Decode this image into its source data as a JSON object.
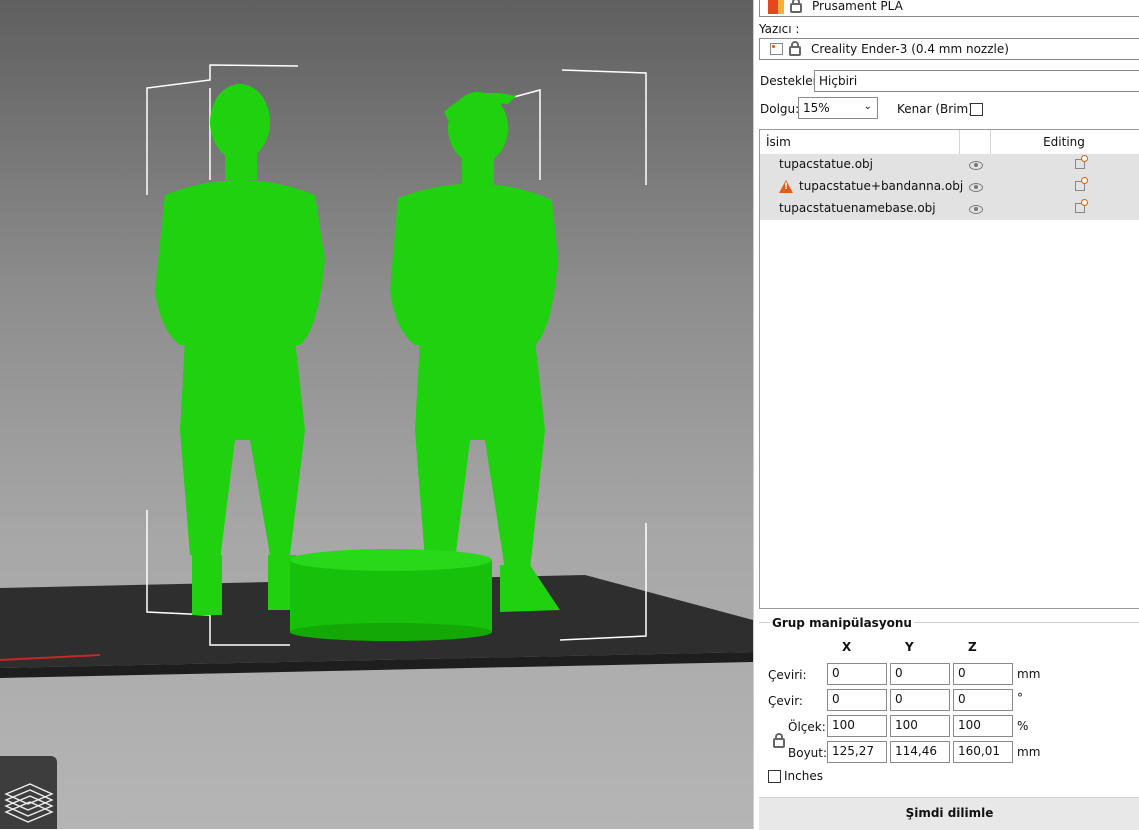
{
  "filament": {
    "value": "Prusament PLA",
    "swatch_colors": [
      "#e8461f",
      "#f2b233"
    ]
  },
  "printer": {
    "label": "Yazıcı :",
    "value": "Creality Ender-3 (0.4 mm nozzle)"
  },
  "supports": {
    "label": "Destekler:",
    "value": "Hiçbiri"
  },
  "infill": {
    "label": "Dolgu:",
    "value": "15%"
  },
  "brim": {
    "label": "Kenar (Brim):",
    "checked": false
  },
  "object_list": {
    "col_name": "İsim",
    "col_editing": "Editing",
    "items": [
      {
        "name": "tupacstatue.obj",
        "warning": false
      },
      {
        "name": "tupacstatue+bandanna.obj",
        "warning": true
      },
      {
        "name": "tupacstatuenamebase.obj",
        "warning": false
      }
    ]
  },
  "group_manipulation": {
    "title": "Grup manipülasyonu",
    "axes": [
      "X",
      "Y",
      "Z"
    ],
    "rows": [
      {
        "label": "Çeviri:",
        "values": [
          "0",
          "0",
          "0"
        ],
        "unit": "mm"
      },
      {
        "label": "Çevir:",
        "values": [
          "0",
          "0",
          "0"
        ],
        "unit": "°"
      },
      {
        "label": "Ölçek:",
        "values": [
          "100",
          "100",
          "100"
        ],
        "unit": "%"
      },
      {
        "label": "Boyut:",
        "values": [
          "125,27",
          "114,46",
          "160,01"
        ],
        "unit": "mm"
      }
    ],
    "inches_label": "Inches"
  },
  "slice_button": "Şimdi dilimle",
  "colors": {
    "model_green": "#1fd10f",
    "bed": "#2f2f2f",
    "accent_orange": "#e85a00"
  }
}
